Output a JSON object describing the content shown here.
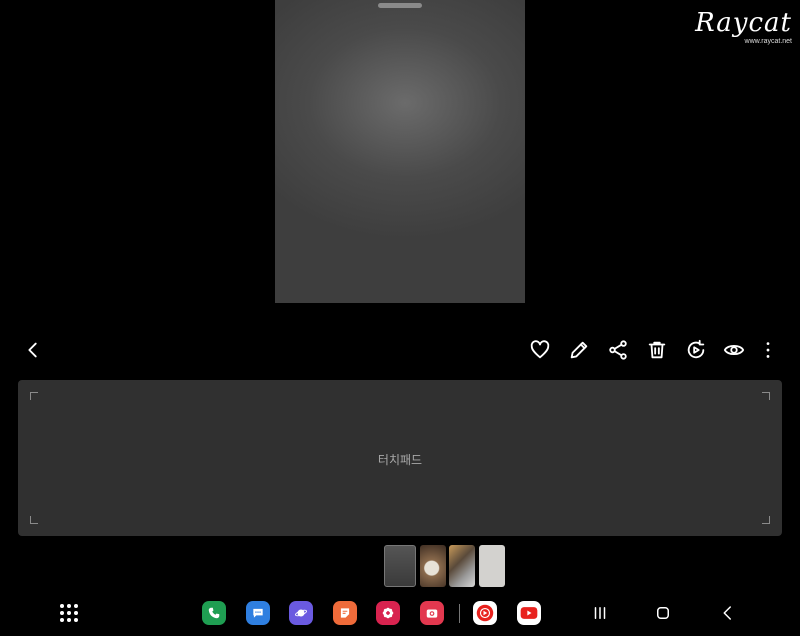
{
  "watermark": {
    "logo": "Raycat",
    "url": "www.raycat.net"
  },
  "toolbar": {
    "icons": [
      "back-icon",
      "heart-icon",
      "edit-icon",
      "share-icon",
      "delete-icon",
      "remaster-icon",
      "view-icon",
      "more-icon"
    ]
  },
  "touchpad": {
    "label": "터치패드"
  },
  "thumbnails": {
    "count": 4,
    "selected_index": 0
  },
  "taskbar": {
    "apps": [
      {
        "name": "phone",
        "color": "#1f9e52"
      },
      {
        "name": "messages",
        "color": "#2f7fe0"
      },
      {
        "name": "internet",
        "color": "#6a5ae0"
      },
      {
        "name": "notes",
        "color": "#ef6b3a"
      },
      {
        "name": "gallery",
        "color": "#d8234f"
      },
      {
        "name": "camera",
        "color": "#e2384f"
      },
      {
        "name": "youtube-music",
        "color": "#ffffff"
      },
      {
        "name": "youtube",
        "color": "#ffffff"
      }
    ],
    "nav": [
      "recents-icon",
      "home-icon",
      "back-nav-icon"
    ]
  }
}
